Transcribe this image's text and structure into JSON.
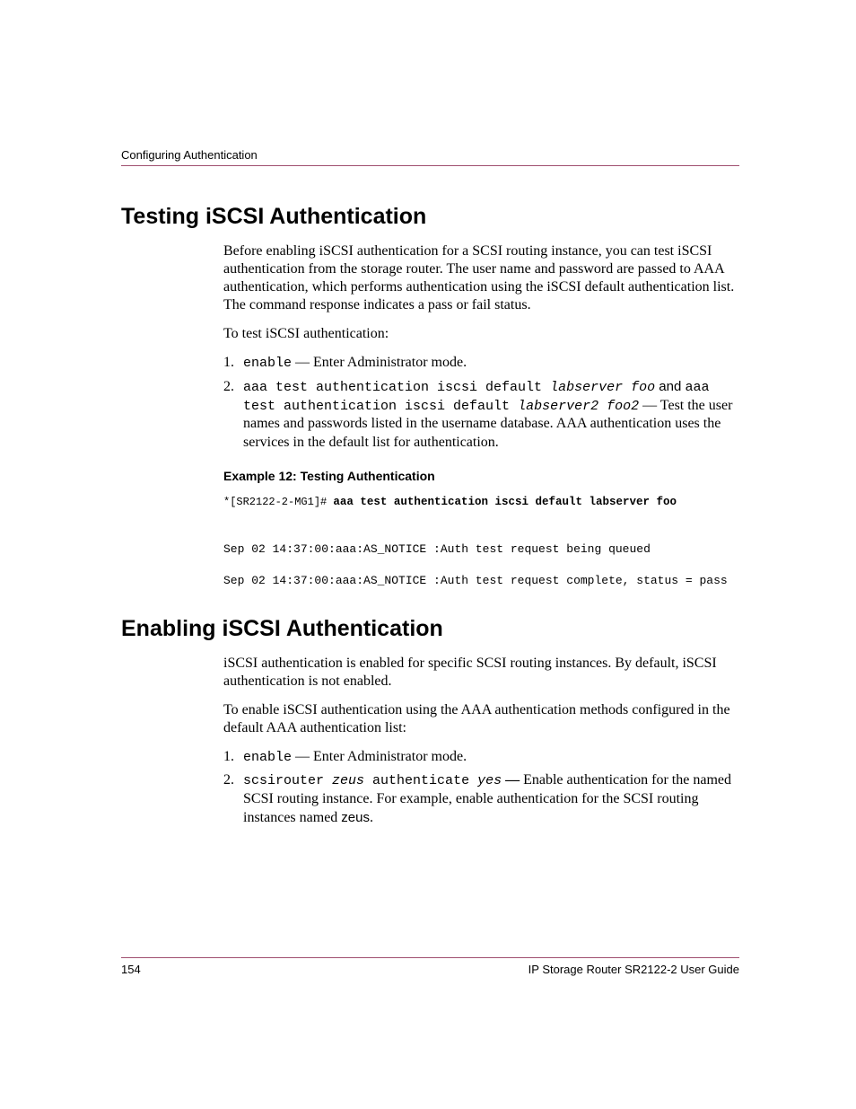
{
  "header": {
    "label": "Configuring Authentication"
  },
  "section1": {
    "heading": "Testing iSCSI Authentication",
    "para1": "Before enabling iSCSI authentication for a SCSI routing instance, you can test iSCSI authentication from the storage router. The user name and password are passed to AAA authentication, which performs authentication using the iSCSI default authentication list. The command response indicates a pass or fail status.",
    "para2": "To test iSCSI authentication:",
    "step1_num": "1.",
    "step1_cmd": "enable",
    "step1_text": " — Enter Administrator mode.",
    "step2_num": "2.",
    "step2_cmd1": "aaa test authentication iscsi default ",
    "step2_var1": "labserver foo",
    "step2_and": " and ",
    "step2_cmd2": "aaa test authentication iscsi default ",
    "step2_var2": "labserver2 foo2",
    "step2_text": "  —  Test the user names and passwords listed in the username database. AAA authentication uses the services in the default list for authentication.",
    "example_label": "Example 12:  Testing Authentication",
    "code_prompt": "*[SR2122-2-MG1]# ",
    "code_cmd": "aaa test authentication iscsi default labserver foo",
    "code_out1": "Sep 02 14:37:00:aaa:AS_NOTICE :Auth test request being queued",
    "code_out2": "Sep 02 14:37:00:aaa:AS_NOTICE :Auth test request complete, status = pass"
  },
  "section2": {
    "heading": "Enabling iSCSI Authentication",
    "para1": "iSCSI authentication is enabled for specific SCSI routing instances. By default, iSCSI authentication is not enabled.",
    "para2": "To enable iSCSI authentication using the AAA authentication methods configured in the default AAA authentication list:",
    "step1_num": "1.",
    "step1_cmd": "enable",
    "step1_text": " — Enter Administrator mode.",
    "step2_num": "2.",
    "step2_cmd_a": "scsirouter ",
    "step2_var_a": "zeus",
    "step2_cmd_b": " authenticate ",
    "step2_var_b": "yes",
    "step2_dash": " — ",
    "step2_text_a": "Enable authentication for the named SCSI routing instance. For example, enable authentication for the SCSI routing instances named ",
    "step2_zeus": "zeus",
    "step2_period": "."
  },
  "footer": {
    "page": "154",
    "title": "IP Storage Router SR2122-2 User Guide"
  }
}
